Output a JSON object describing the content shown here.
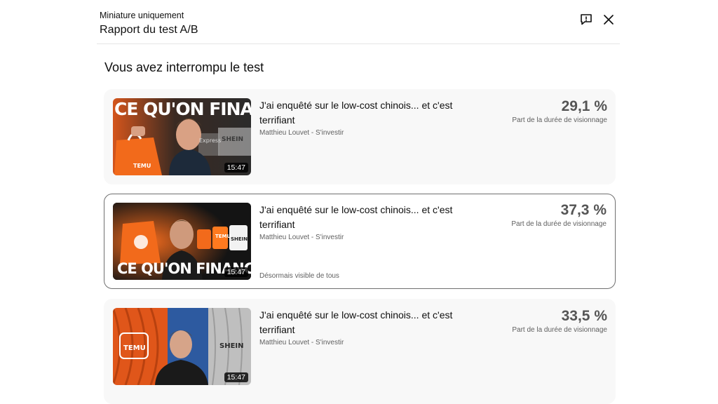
{
  "header": {
    "subtitle": "Miniature uniquement",
    "title": "Rapport du test A/B"
  },
  "section_title": "Vous avez interrompu le test",
  "variants": [
    {
      "title": "J'ai enquêté sur le low-cost chinois... et c'est terrifiant",
      "channel": "Matthieu Louvet - S'investir",
      "duration": "15:47",
      "percent": "29,1 %",
      "metric_label": "Part de la durée de visionnage",
      "thumb_text": "CE QU'ON FINANCE",
      "brand_a": "TEMU",
      "brand_b": "SHEIN",
      "brand_c": "Express"
    },
    {
      "title": "J'ai enquêté sur le low-cost chinois... et c'est terrifiant",
      "channel": "Matthieu Louvet - S'investir",
      "duration": "15:47",
      "percent": "37,3 %",
      "metric_label": "Part de la durée de visionnage",
      "note": "Désormais visible de tous",
      "thumb_text": "CE QU'ON FINANCE",
      "brand_a": "TEMU",
      "brand_b": "SHEIN"
    },
    {
      "title": "J'ai enquêté sur le low-cost chinois... et c'est terrifiant",
      "channel": "Matthieu Louvet - S'investir",
      "duration": "15:47",
      "percent": "33,5 %",
      "metric_label": "Part de la durée de visionnage",
      "brand_a": "TEMU",
      "brand_b": "SHEIN"
    }
  ],
  "colors": {
    "accent_orange": "#f26a1b",
    "card_bg": "#f8f8f8",
    "selected_border": "#6f6f6f"
  }
}
